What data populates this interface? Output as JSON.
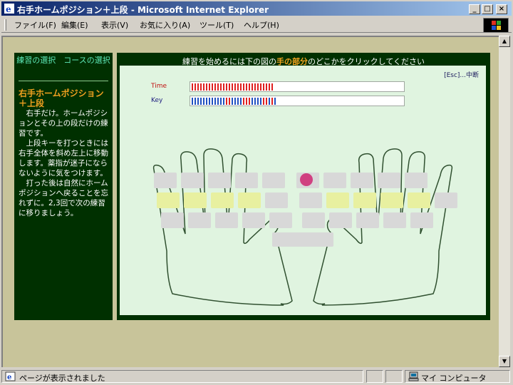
{
  "window": {
    "title": "右手ホームポジション＋上段 - Microsoft Internet Explorer",
    "minimize": "_",
    "maximize": "□",
    "close": "×"
  },
  "menu": [
    "ファイル(F)",
    "編集(E)",
    "表示(V)",
    "お気に入り(A)",
    "ツール(T)",
    "ヘルプ(H)"
  ],
  "sidebar": {
    "link_practice": "練習の選択",
    "link_course": "コースの選択",
    "heading": "右手ホームポジション＋上段",
    "description": "　右手だけ。ホームポジションとその上の段だけの練習です。\n　上段キーを打つときには右手全体を斜め左上に移動します。薬指が迷子にならないように気をつけます。\n　打った後は自然にホームポジションへ戻ることを忘れずに。2,3回で次の練習に移りましょう。"
  },
  "main": {
    "instruction_before": "練習を始めるには下の図の",
    "instruction_highlight": "手の部分",
    "instruction_after": "のどこかをクリックしてください",
    "esc_link": "[Esc]...中断",
    "time_label": "Time",
    "key_label": "Key",
    "time_progress": 0.38,
    "key_progress": 0.4
  },
  "status": {
    "text": "ページが表示されました",
    "zone": "マイ コンピュータ"
  },
  "colors": {
    "sidebar_bg": "#003000",
    "accent_orange": "#f0a020",
    "nav_link": "#5ee8b8",
    "panel_bg": "#e0f4e0",
    "home_key": "#e8f0a0",
    "key": "#d8d8d8",
    "marker": "#d04080",
    "time_bar": "#e02020",
    "key_bar_blue": "#2050c0",
    "key_bar_red": "#e02020"
  }
}
